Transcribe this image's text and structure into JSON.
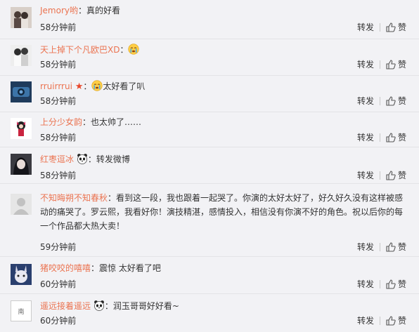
{
  "colors": {
    "username": "#eb7350",
    "background": "#f2f2f5",
    "text": "#333333",
    "divider": "#e3e3e6"
  },
  "comments": [
    {
      "user": "Jemory哟",
      "sep": "：",
      "text": "真的好看",
      "time": "58分钟前",
      "repost": "转发",
      "like": "赞",
      "avatar_icon": "avatar-photo-couple",
      "badge": "",
      "emoji": ""
    },
    {
      "user": "天上掉下个凡欧巴XD",
      "sep": "：",
      "text": "",
      "time": "58分钟前",
      "repost": "转发",
      "like": "赞",
      "avatar_icon": "avatar-photo-couple",
      "badge": "",
      "emoji": "crying-face-emoji"
    },
    {
      "user": "rruirrrui",
      "sep": "：",
      "text": "太好看了叭",
      "time": "58分钟前",
      "repost": "转发",
      "like": "赞",
      "avatar_icon": "avatar-photo-blue",
      "badge": "star-icon",
      "emoji": "crying-face-emoji"
    },
    {
      "user": "上分少女韵",
      "sep": "：",
      "text": "也太帅了……",
      "time": "58分钟前",
      "repost": "转发",
      "like": "赞",
      "avatar_icon": "avatar-cartoon-character",
      "badge": "",
      "emoji": ""
    },
    {
      "user": "红枣逗冰",
      "sep": "：",
      "text": "转发微博",
      "time": "58分钟前",
      "repost": "转发",
      "like": "赞",
      "avatar_icon": "avatar-photo-dark",
      "badge": "",
      "emoji": "panda-emoji"
    },
    {
      "user": "不知晦朔不知春秋",
      "sep": "：",
      "text": "看到这一段，我也跟着一起哭了。你演的太好太好了，好久好久没有这样被感动的痛哭了。罗云熙，我看好你！演技精湛，感情投入，相信没有你演不好的角色。祝以后你的每一个作品都大热大卖！",
      "time": "59分钟前",
      "repost": "转发",
      "like": "赞",
      "avatar_icon": "avatar-default-gray",
      "badge": "",
      "emoji": ""
    },
    {
      "user": "猪咬咬的嘻嘻",
      "sep": "：",
      "text": "震惊 太好看了吧",
      "time": "60分钟前",
      "repost": "转发",
      "like": "赞",
      "avatar_icon": "avatar-cartoon-rabbit",
      "badge": "",
      "emoji": ""
    },
    {
      "user": "遥远接着遥远",
      "sep": "：",
      "text": "润玉哥哥好好看~",
      "time": "60分钟前",
      "repost": "转发",
      "like": "赞",
      "avatar_icon": "avatar-text-logo",
      "avatar_text": "南",
      "badge": "",
      "emoji": "panda-emoji"
    }
  ]
}
